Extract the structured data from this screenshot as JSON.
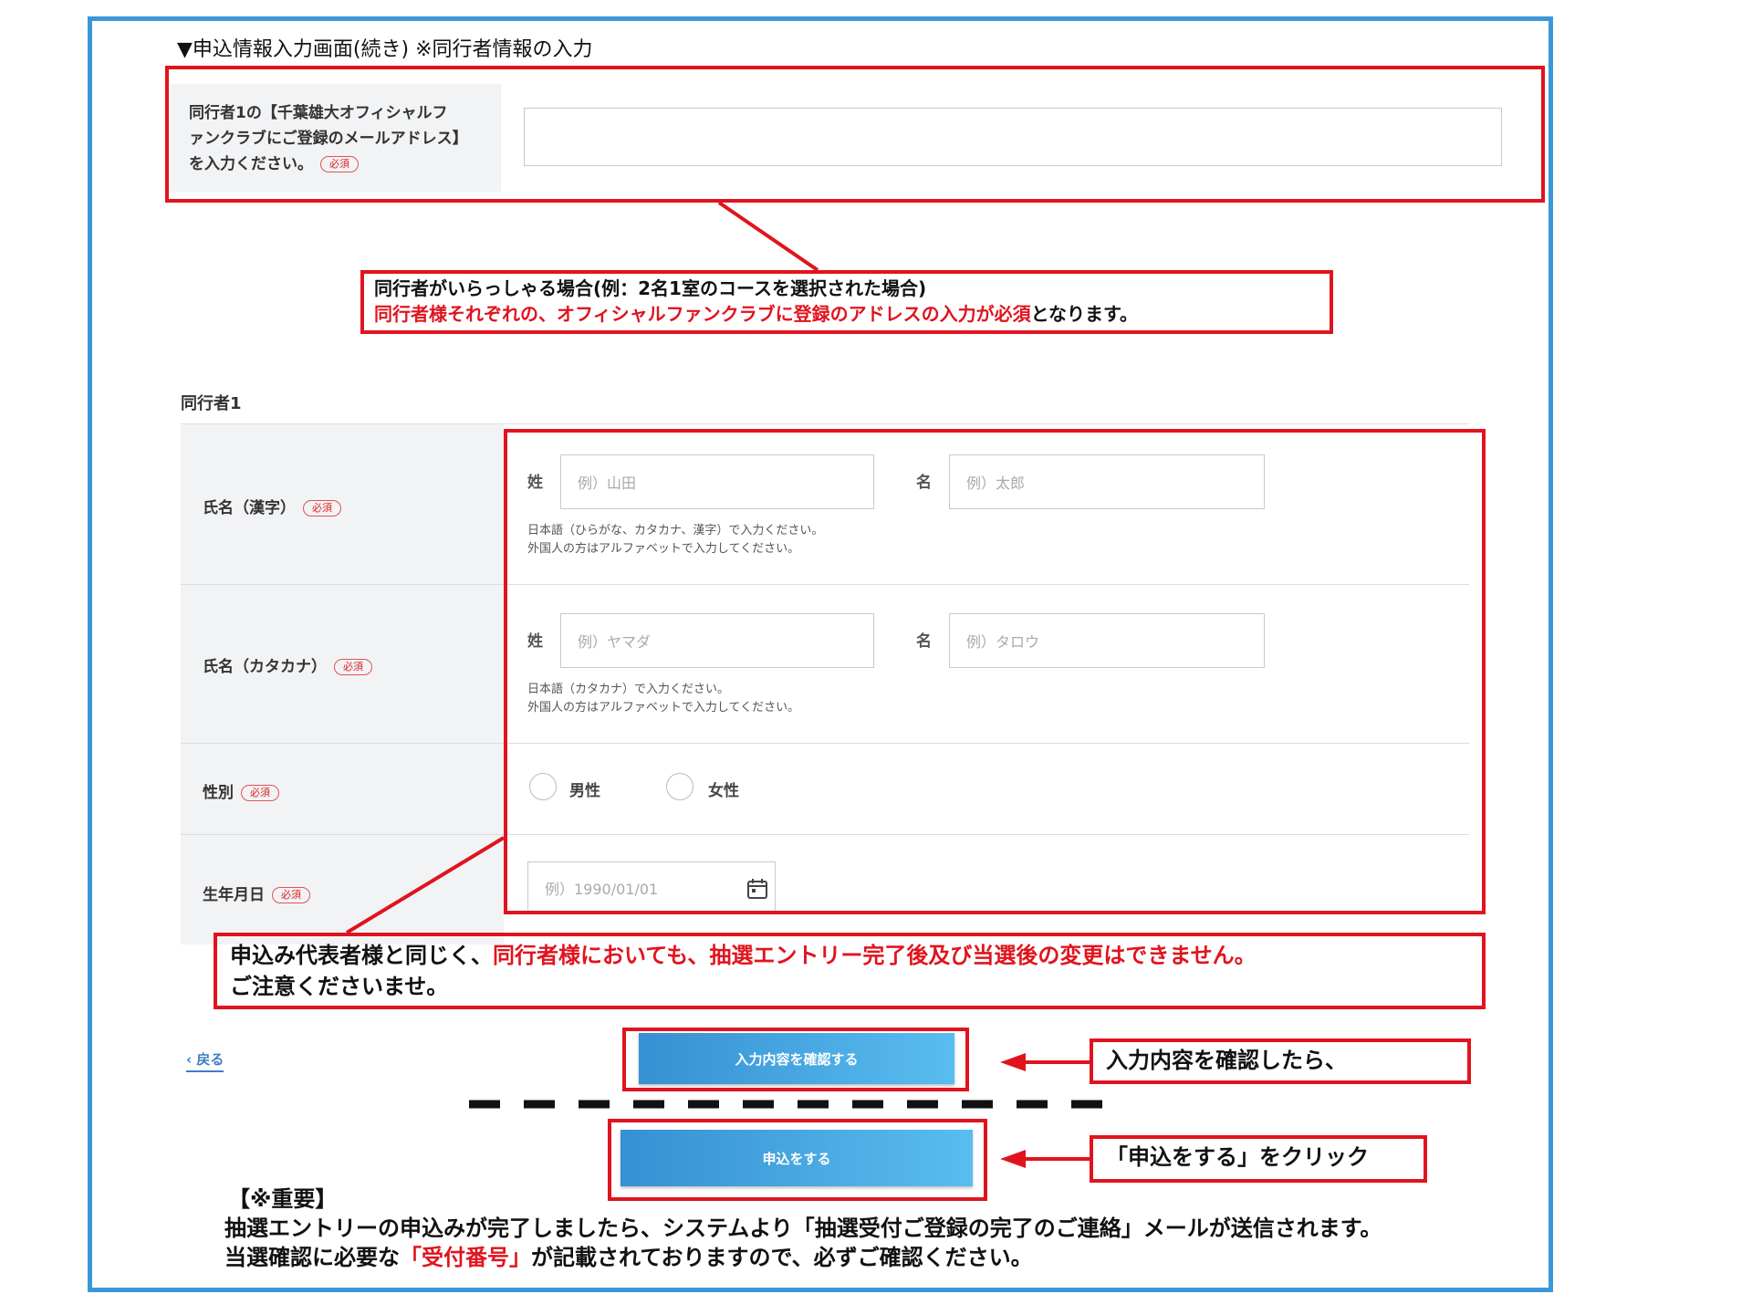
{
  "heading": "▼申込情報入力画面(続き) ※同行者情報の入力",
  "email_block": {
    "label_line1": "同行者1の【千葉雄大オフィシャルフ",
    "label_line2": "ァンクラブにご登録のメールアドレス】",
    "label_line3": "を入力ください。",
    "required_badge": "必須",
    "input_value": ""
  },
  "callout1": {
    "line1": "同行者がいらっしゃる場合(例：2名1室のコースを選択された場合)",
    "line2_red": "同行者様それぞれの、オフィシャルファンクラブに登録のアドレスの入力が必須",
    "line2_tail": "となります。"
  },
  "companion_title": "同行者1",
  "form": {
    "name_kanji": {
      "label": "氏名（漢字）",
      "required_badge": "必須",
      "last_label": "姓",
      "last_placeholder": "例）山田",
      "first_label": "名",
      "first_placeholder": "例）太郎",
      "help1": "日本語（ひらがな、カタカナ、漢字）で入力ください。",
      "help2": "外国人の方はアルファベットで入力してください。"
    },
    "name_kana": {
      "label": "氏名（カタカナ）",
      "required_badge": "必須",
      "last_label": "姓",
      "last_placeholder": "例）ヤマダ",
      "first_label": "名",
      "first_placeholder": "例）タロウ",
      "help1": "日本語（カタカナ）で入力ください。",
      "help2": "外国人の方はアルファベットで入力してください。"
    },
    "gender": {
      "label": "性別",
      "required_badge": "必須",
      "option_male": "男性",
      "option_female": "女性"
    },
    "birthdate": {
      "label": "生年月日",
      "required_badge": "必須",
      "placeholder": "例）1990/01/01",
      "icon": "calendar-icon"
    }
  },
  "callout2": {
    "line1_head": "申込み代表者様と同じく、",
    "line1_red": "同行者様においても、抽選エントリー完了後及び当選後の変更はできません。",
    "line2": "ご注意くださいませ。"
  },
  "back_link": "‹ 戻る",
  "confirm_button": "入力内容を確認する",
  "confirm_note": "入力内容を確認したら、",
  "apply_button": "申込をする",
  "apply_note": "「申込をする」をクリック",
  "important": {
    "title": "【※重要】",
    "line1": "抽選エントリーの申込みが完了しましたら、システムより「抽選受付ご登録の完了のご連絡」メールが送信されます。",
    "line2_head": "当選確認に必要な",
    "line2_red": "「受付番号」",
    "line2_tail": "が記載されておりますので、必ずご確認ください。"
  },
  "colors": {
    "accent_red": "#e0141e",
    "frame_blue": "#3b98d8",
    "button_blue": "#3690d2"
  }
}
